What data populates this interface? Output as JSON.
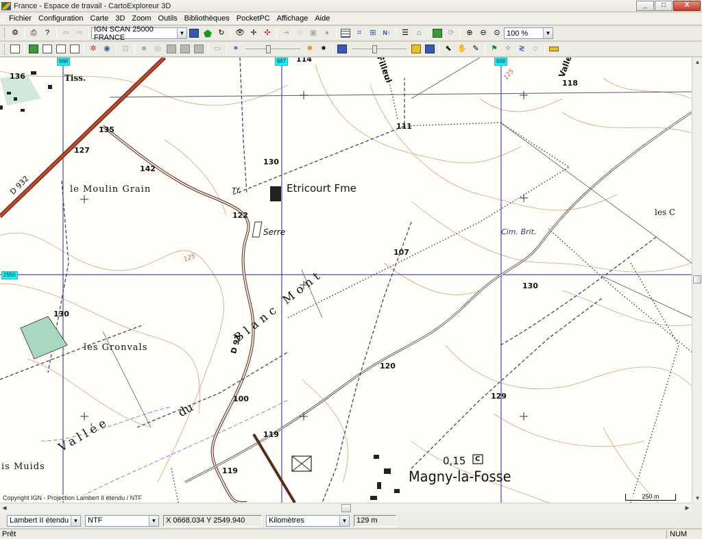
{
  "window": {
    "title": "France - Espace de travail - CartoExploreur 3D",
    "minimize": "_",
    "maximize": "□",
    "close": "X"
  },
  "menu": [
    "Fichier",
    "Configuration",
    "Carte",
    "3D",
    "Zoom",
    "Outils",
    "Bibliothèques",
    "PocketPC",
    "Affichage",
    "Aide"
  ],
  "toolbar": {
    "map_select": "IGN SCAN 25000 FRANCE",
    "zoom_select": "100 %",
    "north_label": "N↑"
  },
  "map": {
    "grid_x_labels": [
      "666",
      "667",
      "668"
    ],
    "grid_y_label": "2550",
    "labels": {
      "tiss": "Tiss.",
      "n136": "136",
      "n135": "135",
      "n127": "127",
      "n142": "142",
      "d932": "D 932",
      "moulin": "le Moulin Grain",
      "tf": "Tf.",
      "etricourt": "Etricourt Fme",
      "n130a": "130",
      "n122": "122",
      "serre": "Serre",
      "n114": "114",
      "filleul": "Filleul",
      "n111": "111",
      "n107": "107",
      "valle": "Valle",
      "n118": "118",
      "lesc": "les C",
      "cim": "Cim. Brit.",
      "n130b": "130",
      "n125a": "125",
      "n125b": "125",
      "n130c": "130",
      "gronvals": "les Gronvals",
      "d93": "D 93",
      "blancmont": "Blanc  Mont",
      "du": "du",
      "vallee": "Vallée",
      "n100": "100",
      "n120": "120",
      "n129": "129",
      "n119a": "119",
      "n119b": "119",
      "muids": "is Muids",
      "n015": "0,15",
      "c_box": "C",
      "magny": "Magny-la-Fosse"
    },
    "copyright": "Copyright IGN - Projection Lambert II étendu / NTF",
    "scale": "250 m",
    "colors": {
      "road": "#c8462a",
      "contour": "#e08a6a",
      "grid": "#2020c0",
      "path": "#444466"
    }
  },
  "statusbar": {
    "projection": "Lambert II étendu",
    "datum": "NTF",
    "coords": "X 0668.034  Y 2549.940",
    "units": "Kilomètres",
    "altitude": "129 m",
    "status": "Prêt",
    "num": "NUM"
  }
}
